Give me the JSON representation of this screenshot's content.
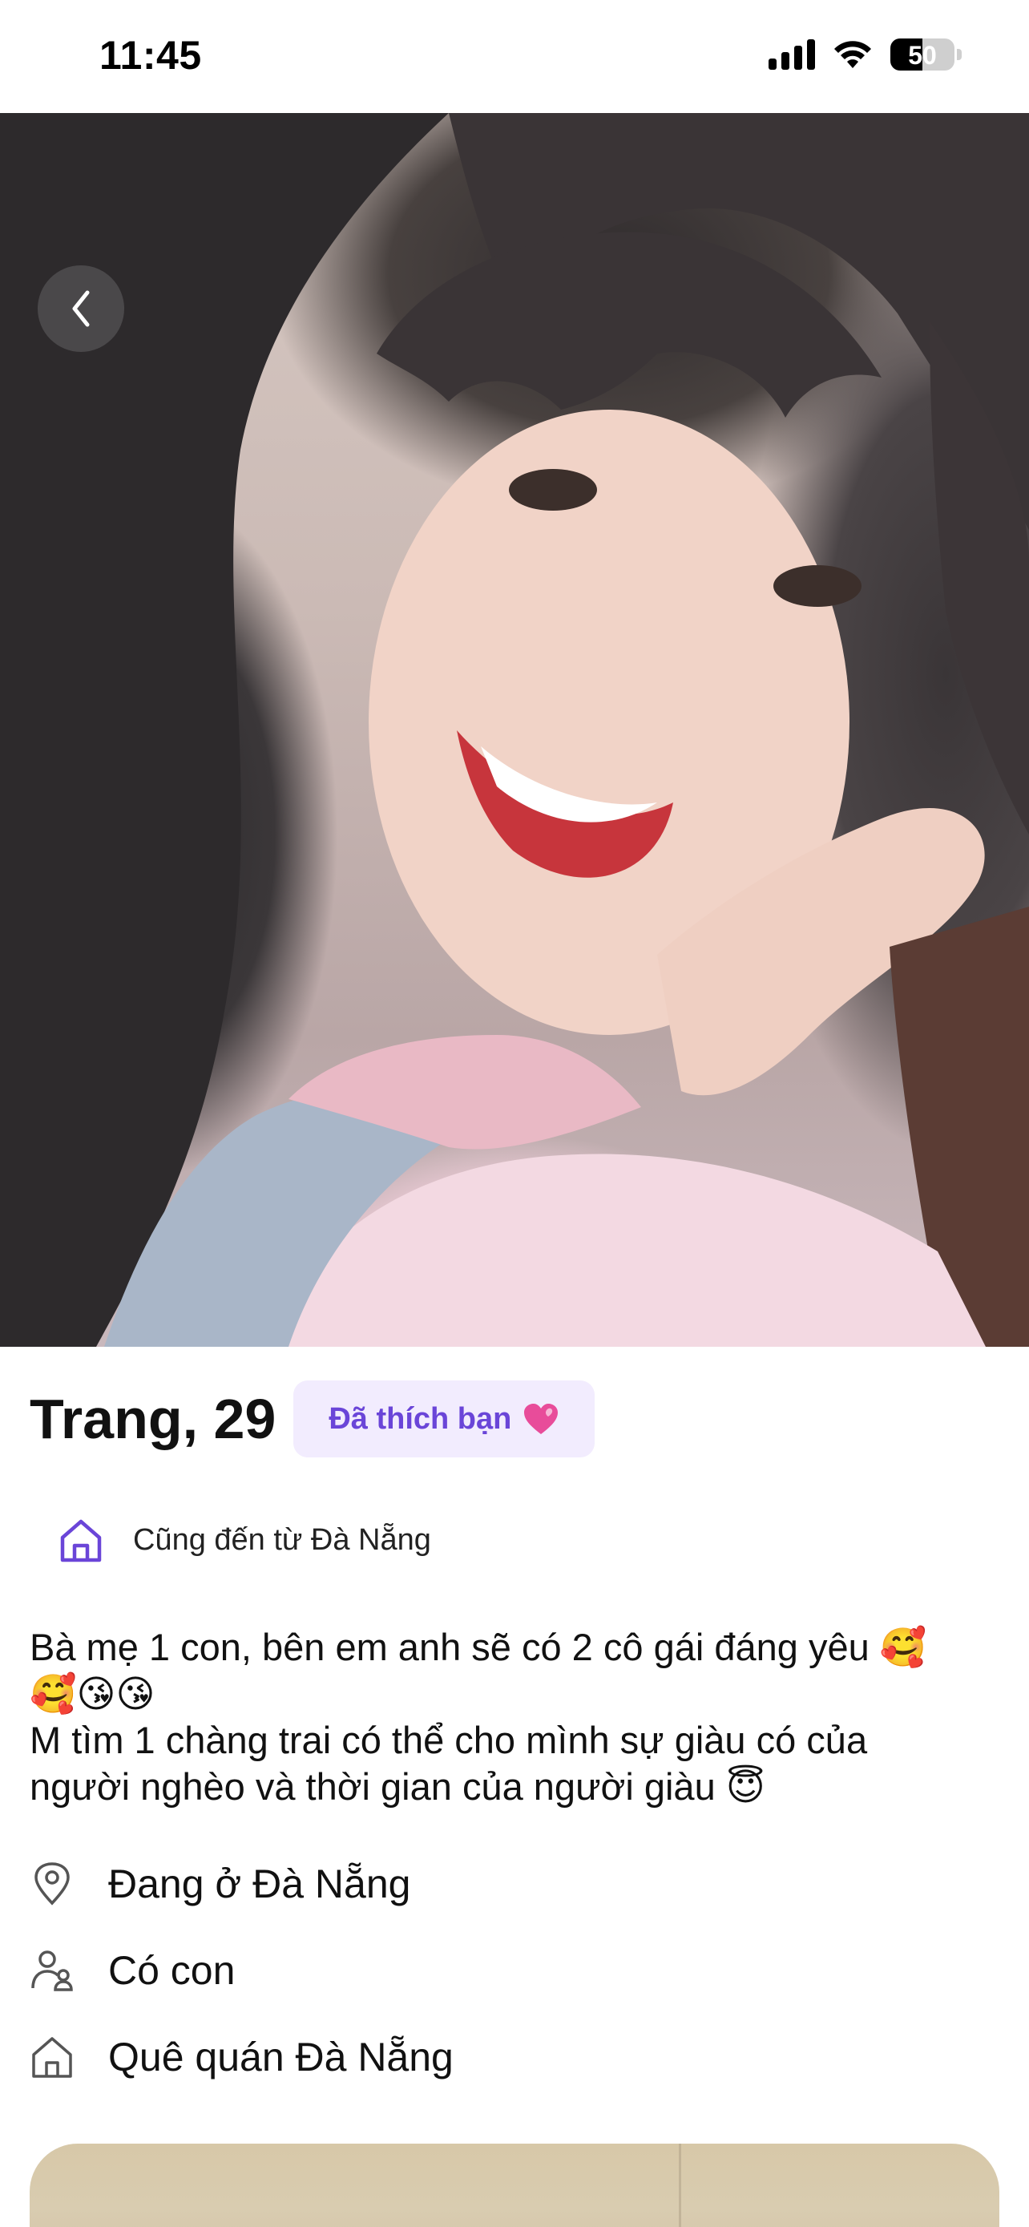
{
  "status_bar": {
    "time": "11:45",
    "battery": "50",
    "battery_level": 0.5
  },
  "profile": {
    "name_age": "Trang, 29",
    "liked_badge": "Đã thích bạn",
    "hometown_tag": "Cũng đến từ Đà Nẵng",
    "bio_lines": [
      "Bà mẹ 1 con, bên em anh sẽ có 2 cô gái đáng yêu 🥰",
      "🥰😘😘",
      "M tìm 1 chàng trai có thể cho mình sự giàu có của",
      "người nghèo và thời gian của người giàu 😇"
    ],
    "details": [
      {
        "icon": "location-pin-icon",
        "label": "Đang ở Đà Nẵng"
      },
      {
        "icon": "parent-child-icon",
        "label": "Có con"
      },
      {
        "icon": "home-icon",
        "label": "Quê quán Đà Nẵng"
      }
    ]
  },
  "colors": {
    "accent": "#6a45d8",
    "badge_bg": "#f2ecfe",
    "icon_gray": "#555555"
  }
}
